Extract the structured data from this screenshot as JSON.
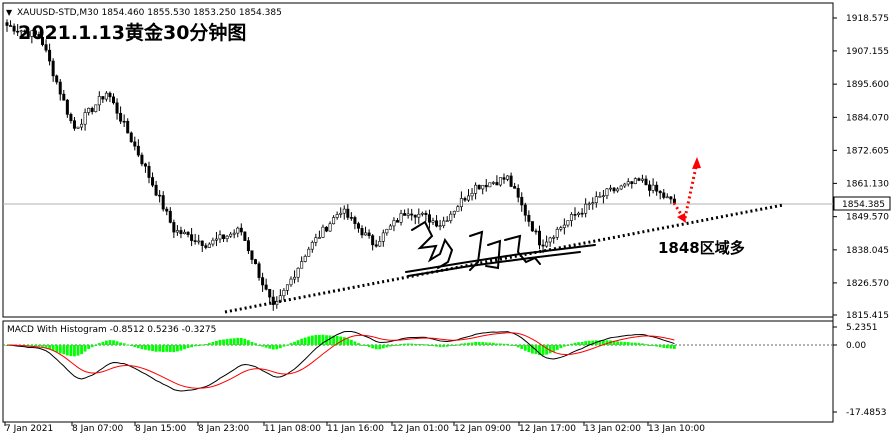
{
  "header": {
    "symbol_line": "XAUUSD-STD,M30  1854.460 1855.530 1853.250 1854.385",
    "title_overlay": "2021.1.13黄金30分钟图"
  },
  "price_axis": {
    "ticks": [
      "1918.575",
      "1907.155",
      "1895.600",
      "1884.070",
      "1872.605",
      "1861.130",
      "1849.570",
      "1838.045",
      "1826.570",
      "1815.415"
    ],
    "current_price": "1854.385"
  },
  "macd_panel": {
    "label": "MACD With Histogram -0.8512 0.5236 -0.3275",
    "ticks": [
      "5.2351",
      "0.00",
      "-17.4853"
    ]
  },
  "time_axis": {
    "ticks": [
      "7 Jan 2021",
      "8 Jan 07:00",
      "8 Jan 15:00",
      "8 Jan 23:00",
      "11 Jan 08:00",
      "11 Jan 16:00",
      "12 Jan 01:00",
      "12 Jan 09:00",
      "12 Jan 17:00",
      "13 Jan 02:00",
      "13 Jan 10:00"
    ]
  },
  "annotation": {
    "support_text": "1848区域多"
  },
  "colors": {
    "bull_candle": "#ffffff",
    "bear_candle": "#000000",
    "histogram": "#00ff00",
    "signal_line": "#ff0000",
    "macd_line": "#000000",
    "arrow": "#ff0000"
  },
  "chart_data": {
    "type": "candlestick",
    "timeframe": "M30",
    "symbol": "XAUUSD-STD",
    "last": {
      "open": 1854.46,
      "high": 1855.53,
      "low": 1853.25,
      "close": 1854.385
    },
    "close_path": [
      [
        "7 Jan 2021",
        1916.0
      ],
      [
        "8 Jan 07:00",
        1912.0
      ],
      [
        "8 Jan 07:00",
        1880.0
      ],
      [
        "8 Jan 07:00",
        1893.0
      ],
      [
        "8 Jan 15:00",
        1870.0
      ],
      [
        "8 Jan 15:00",
        1845.0
      ],
      [
        "8 Jan 15:00",
        1840.0
      ],
      [
        "8 Jan 23:00",
        1845.0
      ],
      [
        "8 Jan 23:00",
        1817.0
      ],
      [
        "8 Jan 23:00",
        1838.0
      ],
      [
        "11 Jan 08:00",
        1852.0
      ],
      [
        "11 Jan 16:00",
        1840.0
      ],
      [
        "11 Jan 16:00",
        1852.0
      ],
      [
        "12 Jan 01:00",
        1847.0
      ],
      [
        "12 Jan 01:00",
        1860.0
      ],
      [
        "12 Jan 09:00",
        1863.0
      ],
      [
        "12 Jan 09:00",
        1840.0
      ],
      [
        "12 Jan 17:00",
        1850.0
      ],
      [
        "12 Jan 17:00",
        1858.0
      ],
      [
        "13 Jan 02:00",
        1862.0
      ],
      [
        "13 Jan 10:00",
        1854.0
      ]
    ],
    "macd": {
      "macd": -0.8512,
      "signal": 0.5236,
      "histogram": -0.3275
    },
    "ylim": [
      1815.415,
      1918.575
    ],
    "macd_ylim": [
      -17.4853,
      5.2351
    ],
    "annotation": "1848区域多"
  }
}
